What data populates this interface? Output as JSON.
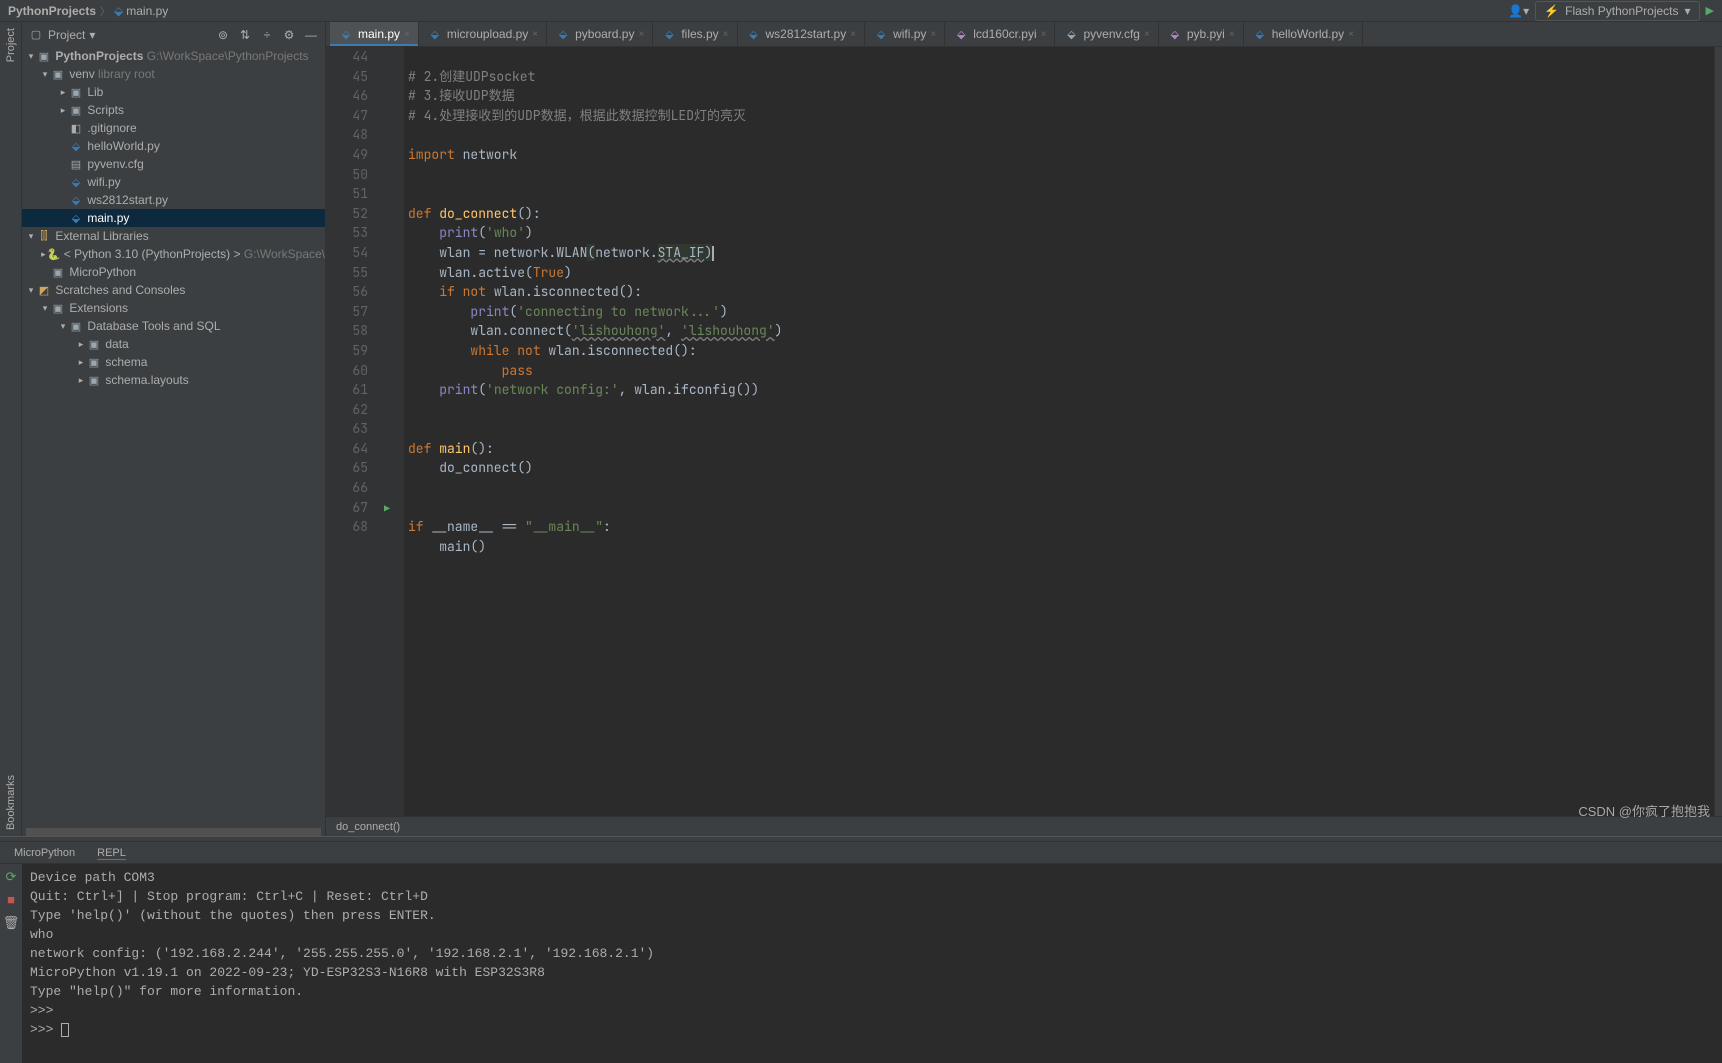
{
  "breadcrumb": {
    "root": "PythonProjects",
    "file": "main.py"
  },
  "run_config": "Flash PythonProjects",
  "project_panel": {
    "title": "Project",
    "root": {
      "name": "PythonProjects",
      "path": "G:\\WorkSpace\\PythonProjects"
    },
    "venv": {
      "name": "venv",
      "hint": "library root"
    },
    "venv_children": [
      "Lib",
      "Scripts"
    ],
    "files": [
      ".gitignore",
      "helloWorld.py",
      "pyvenv.cfg",
      "wifi.py",
      "ws2812start.py",
      "main.py"
    ],
    "ext_libs": "External Libraries",
    "python": "< Python 3.10 (PythonProjects) >",
    "python_path": "G:\\WorkSpace\\",
    "micropython": "MicroPython",
    "scratches": "Scratches and Consoles",
    "extensions": "Extensions",
    "db_tools": "Database Tools and SQL",
    "db_children": [
      "data",
      "schema",
      "schema.layouts"
    ]
  },
  "tabs": [
    "main.py",
    "microupload.py",
    "pyboard.py",
    "files.py",
    "ws2812start.py",
    "wifi.py",
    "lcd160cr.pyi",
    "pyvenv.cfg",
    "pyb.pyi",
    "helloWorld.py"
  ],
  "tab_types": [
    "py",
    "py",
    "py",
    "py",
    "py",
    "py",
    "pyi",
    "cfg",
    "pyi",
    "py"
  ],
  "gutter_lines": [
    "44",
    "45",
    "46",
    "47",
    "48",
    "49",
    "50",
    "51",
    "52",
    "53",
    "54",
    "55",
    "56",
    "57",
    "58",
    "59",
    "60",
    "61",
    "62",
    "63",
    "64",
    "65",
    "66",
    "67",
    "68"
  ],
  "crumb_trail": "do_connect()",
  "code": {
    "l44": "# 2.创建UDPsocket",
    "l45": "# 3.接收UDP数据",
    "l46": "# 4.处理接收到的UDP数据，根据此数据控制LED灯的亮灭",
    "l48_import": "import ",
    "l48_net": "network",
    "def": "def ",
    "l51_fn": "do_connect",
    "l52_print": "print",
    "l52_arg": "'who'",
    "l53_a": "wlan = network.WLAN",
    "l53_b": "network.",
    "l53_c": "STA_IF",
    "l54_a": "wlan.active(",
    "l54_b": "True",
    "if": "if ",
    "not": "not ",
    "l55_b": "wlan.isconnected():",
    "l56_a": "print",
    "l56_b": "'connecting to network...'",
    "l57_a": "wlan.connect(",
    "l57_b": "'lishouhong'",
    "l57_c": "'lishouhong'",
    "while": "while ",
    "l58_b": "wlan.isconnected():",
    "pass": "pass",
    "l60_a": "print",
    "l60_b": "'network config:'",
    "l60_c": ", wlan.ifconfig())",
    "l63_fn": "main",
    "l64": "do_connect()",
    "l67_a": "__name__ == ",
    "l67_b": "\"__main__\"",
    "l68": "main()"
  },
  "bottom_tabs": [
    "MicroPython",
    "REPL"
  ],
  "terminal": {
    "l1": "Device path COM3",
    "l2": "Quit: Ctrl+] | Stop program: Ctrl+C | Reset: Ctrl+D",
    "l3": "Type 'help()' (without the quotes) then press ENTER.",
    "l4": "who",
    "l5": "network config: ('192.168.2.244', '255.255.255.0', '192.168.2.1', '192.168.2.1')",
    "l6": "MicroPython v1.19.1 on 2022-09-23; YD-ESP32S3-N16R8 with ESP32S3R8",
    "l7": "Type \"help()\" for more information.",
    "l8": ">>> ",
    "l9": ">>> "
  },
  "watermark": "CSDN @你疯了抱抱我",
  "side_tabs": {
    "project": "Project",
    "bookmarks": "Bookmarks"
  }
}
